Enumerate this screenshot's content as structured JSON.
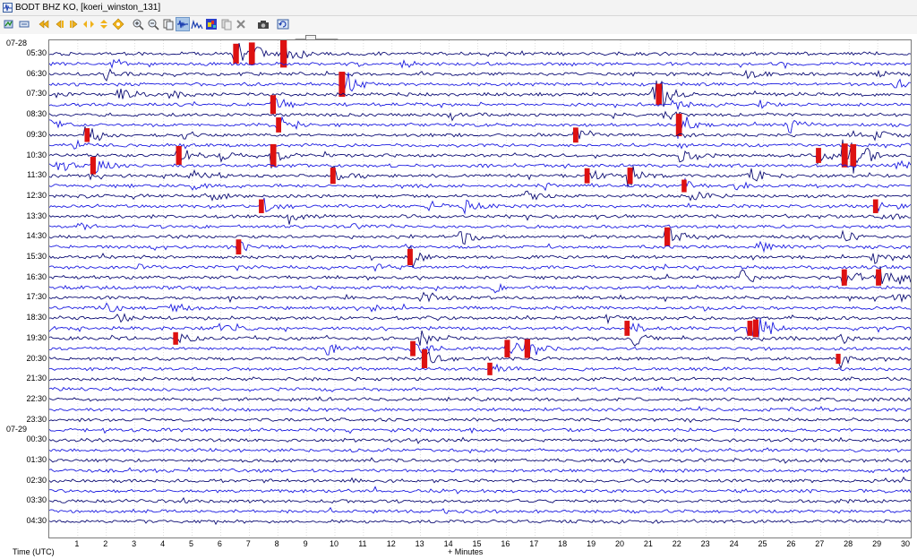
{
  "window": {
    "title": "BODT BHZ KO, [koeri_winston_131]",
    "icon": "helicorder-app-icon"
  },
  "toolbar": {
    "buttons": [
      {
        "name": "pin-icon"
      },
      {
        "name": "config-icon"
      },
      {
        "name": "back-fast-icon"
      },
      {
        "name": "back-icon"
      },
      {
        "name": "forward-icon"
      },
      {
        "name": "expand-icon"
      },
      {
        "name": "compress-icon"
      },
      {
        "name": "gear-diamond-icon"
      },
      {
        "name": "zoom-in-icon"
      },
      {
        "name": "zoom-out-icon"
      },
      {
        "name": "clip-icon"
      },
      {
        "name": "waveform-icon",
        "active": true
      },
      {
        "name": "spectra-icon"
      },
      {
        "name": "spectrogram-icon"
      },
      {
        "name": "copy-icon"
      },
      {
        "name": "close-x-icon"
      },
      {
        "name": "camera-icon"
      },
      {
        "name": "refresh-icon"
      }
    ],
    "slider": {
      "name": "gain-slider",
      "level": 0.38
    }
  },
  "helicorder": {
    "dates": [
      {
        "label": "07-28",
        "row": 0
      },
      {
        "label": "07-29",
        "row": 19
      }
    ],
    "time_labels": [
      {
        "label": "05:30",
        "row": 0
      },
      {
        "label": "06:30",
        "row": 2
      },
      {
        "label": "07:30",
        "row": 4
      },
      {
        "label": "08:30",
        "row": 6
      },
      {
        "label": "09:30",
        "row": 8
      },
      {
        "label": "10:30",
        "row": 10
      },
      {
        "label": "11:30",
        "row": 12
      },
      {
        "label": "12:30",
        "row": 14
      },
      {
        "label": "13:30",
        "row": 16
      },
      {
        "label": "14:30",
        "row": 18
      },
      {
        "label": "15:30",
        "row": 20
      },
      {
        "label": "16:30",
        "row": 22
      },
      {
        "label": "17:30",
        "row": 24
      },
      {
        "label": "18:30",
        "row": 26
      },
      {
        "label": "19:30",
        "row": 28
      },
      {
        "label": "20:30",
        "row": 30
      },
      {
        "label": "21:30",
        "row": 32
      },
      {
        "label": "22:30",
        "row": 34
      },
      {
        "label": "23:30",
        "row": 36
      },
      {
        "label": "00:30",
        "row": 38
      },
      {
        "label": "01:30",
        "row": 40
      },
      {
        "label": "02:30",
        "row": 42
      },
      {
        "label": "03:30",
        "row": 44
      },
      {
        "label": "04:30",
        "row": 46
      }
    ],
    "rows": 47,
    "x_ticks": [
      "1",
      "2",
      "3",
      "4",
      "5",
      "6",
      "7",
      "8",
      "9",
      "10",
      "11",
      "12",
      "13",
      "14",
      "15",
      "16",
      "17",
      "18",
      "19",
      "20",
      "21",
      "22",
      "23",
      "24",
      "25",
      "26",
      "27",
      "28",
      "29",
      "30"
    ],
    "x_axis_label": "+ Minutes",
    "y_axis_label": "Time (UTC)",
    "trace_colors": [
      "#0c0c74",
      "#1c1ce0"
    ],
    "event_color": "#dd1111",
    "events": [
      {
        "row": 0,
        "min": 6.5,
        "amp": 1.6,
        "red": true
      },
      {
        "row": 0,
        "min": 7.05,
        "amp": 1.8,
        "red": true
      },
      {
        "row": 0,
        "min": 8.15,
        "amp": 2.2,
        "red": true
      },
      {
        "row": 1,
        "min": 12.4,
        "amp": 0.5
      },
      {
        "row": 1,
        "min": 2.2,
        "amp": 0.5
      },
      {
        "row": 2,
        "min": 1.9,
        "amp": 0.9
      },
      {
        "row": 2,
        "min": 28.9,
        "amp": 0.6
      },
      {
        "row": 2,
        "min": 24.4,
        "amp": 0.6
      },
      {
        "row": 3,
        "min": 10.2,
        "amp": 2.0,
        "red": true
      },
      {
        "row": 3,
        "min": 29.6,
        "amp": 0.6
      },
      {
        "row": 4,
        "min": 21.3,
        "amp": 1.7,
        "red": true
      },
      {
        "row": 4,
        "min": 21.1,
        "amp": 0.9
      },
      {
        "row": 4,
        "min": 2.4,
        "amp": 0.9
      },
      {
        "row": 4,
        "min": 4.2,
        "amp": 0.9
      },
      {
        "row": 5,
        "min": 7.8,
        "amp": 1.5,
        "red": true
      },
      {
        "row": 5,
        "min": 24.8,
        "amp": 0.7
      },
      {
        "row": 5,
        "min": 21.8,
        "amp": 0.6
      },
      {
        "row": 6,
        "min": 14.0,
        "amp": 0.6
      },
      {
        "row": 6,
        "min": 21.5,
        "amp": 0.6
      },
      {
        "row": 7,
        "min": 0.0,
        "amp": 0.8
      },
      {
        "row": 7,
        "min": 22.0,
        "amp": 1.8,
        "red": true
      },
      {
        "row": 7,
        "min": 25.9,
        "amp": 0.9
      },
      {
        "row": 7,
        "min": 8.0,
        "amp": 1.2,
        "red": true
      },
      {
        "row": 8,
        "min": 1.3,
        "amp": 1.1,
        "red": true
      },
      {
        "row": 8,
        "min": 4.7,
        "amp": 0.8
      },
      {
        "row": 8,
        "min": 18.4,
        "amp": 1.2,
        "red": true
      },
      {
        "row": 8,
        "min": 28.9,
        "amp": 0.7
      },
      {
        "row": 9,
        "min": 0.9,
        "amp": 0.5
      },
      {
        "row": 9,
        "min": 29.3,
        "amp": 0.5
      },
      {
        "row": 10,
        "min": 4.5,
        "amp": 1.5,
        "red": true
      },
      {
        "row": 10,
        "min": 6.0,
        "amp": 0.9
      },
      {
        "row": 10,
        "min": 7.8,
        "amp": 1.8,
        "red": true
      },
      {
        "row": 10,
        "min": 26.9,
        "amp": 1.2,
        "red": true
      },
      {
        "row": 10,
        "min": 27.8,
        "amp": 1.9,
        "red": true
      },
      {
        "row": 10,
        "min": 28.1,
        "amp": 1.8,
        "red": true
      },
      {
        "row": 10,
        "min": 22.1,
        "amp": 0.7
      },
      {
        "row": 11,
        "min": 0.3,
        "amp": 0.8
      },
      {
        "row": 11,
        "min": 1.5,
        "amp": 1.4,
        "red": true
      },
      {
        "row": 11,
        "min": 29.7,
        "amp": 0.6
      },
      {
        "row": 12,
        "min": 5.0,
        "amp": 0.8
      },
      {
        "row": 12,
        "min": 9.9,
        "amp": 1.3,
        "red": true
      },
      {
        "row": 12,
        "min": 18.8,
        "amp": 1.2,
        "red": true
      },
      {
        "row": 12,
        "min": 20.3,
        "amp": 1.3,
        "red": true
      },
      {
        "row": 12,
        "min": 24.5,
        "amp": 1.0
      },
      {
        "row": 13,
        "min": 5.0,
        "amp": 0.6
      },
      {
        "row": 13,
        "min": 17.3,
        "amp": 0.6
      },
      {
        "row": 13,
        "min": 22.2,
        "amp": 1.0,
        "red": true
      },
      {
        "row": 13,
        "min": 23.9,
        "amp": 0.6
      },
      {
        "row": 14,
        "min": 5.6,
        "amp": 0.9
      },
      {
        "row": 14,
        "min": 16.6,
        "amp": 1.2
      },
      {
        "row": 14,
        "min": 22.4,
        "amp": 0.8
      },
      {
        "row": 15,
        "min": 7.4,
        "amp": 1.1,
        "red": true
      },
      {
        "row": 15,
        "min": 13.2,
        "amp": 0.7
      },
      {
        "row": 15,
        "min": 14.5,
        "amp": 1.2
      },
      {
        "row": 15,
        "min": 28.9,
        "amp": 1.1,
        "red": true
      },
      {
        "row": 16,
        "min": 8.4,
        "amp": 0.8
      },
      {
        "row": 16,
        "min": 29.1,
        "amp": 0.5
      },
      {
        "row": 17,
        "min": 1.0,
        "amp": 0.5
      },
      {
        "row": 17,
        "min": 10.6,
        "amp": 0.5
      },
      {
        "row": 18,
        "min": 14.4,
        "amp": 1.2
      },
      {
        "row": 18,
        "min": 21.6,
        "amp": 1.5,
        "red": true
      },
      {
        "row": 18,
        "min": 27.8,
        "amp": 0.8
      },
      {
        "row": 19,
        "min": 6.6,
        "amp": 1.2,
        "red": true
      },
      {
        "row": 19,
        "min": 24.8,
        "amp": 0.7
      },
      {
        "row": 20,
        "min": 12.6,
        "amp": 1.3,
        "red": true
      },
      {
        "row": 20,
        "min": 28.8,
        "amp": 0.8
      },
      {
        "row": 21,
        "min": 11.4,
        "amp": 0.5
      },
      {
        "row": 21,
        "min": 3.0,
        "amp": 0.5
      },
      {
        "row": 22,
        "min": 24.2,
        "amp": 1.0
      },
      {
        "row": 22,
        "min": 27.8,
        "amp": 1.3,
        "red": true
      },
      {
        "row": 22,
        "min": 29.0,
        "amp": 1.3,
        "red": true
      },
      {
        "row": 22,
        "min": 29.8,
        "amp": 0.8
      },
      {
        "row": 23,
        "min": 15.5,
        "amp": 0.6
      },
      {
        "row": 24,
        "min": 13.0,
        "amp": 0.8
      },
      {
        "row": 24,
        "min": 29.5,
        "amp": 0.5
      },
      {
        "row": 25,
        "min": 2.0,
        "amp": 0.8
      },
      {
        "row": 25,
        "min": 4.3,
        "amp": 0.6
      },
      {
        "row": 25,
        "min": 11.3,
        "amp": 0.5
      },
      {
        "row": 26,
        "min": 2.4,
        "amp": 0.7
      },
      {
        "row": 26,
        "min": 19.5,
        "amp": 0.6
      },
      {
        "row": 26,
        "min": 13.0,
        "amp": 0.5
      },
      {
        "row": 27,
        "min": 6.0,
        "amp": 0.6
      },
      {
        "row": 27,
        "min": 20.2,
        "amp": 1.2,
        "red": true
      },
      {
        "row": 27,
        "min": 24.5,
        "amp": 1.2,
        "red": true
      },
      {
        "row": 27,
        "min": 24.7,
        "amp": 1.4,
        "red": true
      },
      {
        "row": 28,
        "min": 4.4,
        "amp": 1.0,
        "red": true
      },
      {
        "row": 28,
        "min": 13.0,
        "amp": 1.0
      },
      {
        "row": 28,
        "min": 20.4,
        "amp": 1.0
      },
      {
        "row": 28,
        "min": 27.6,
        "amp": 0.7
      },
      {
        "row": 29,
        "min": 9.7,
        "amp": 0.9
      },
      {
        "row": 29,
        "min": 12.7,
        "amp": 1.2,
        "red": true
      },
      {
        "row": 29,
        "min": 16.0,
        "amp": 1.4,
        "red": true
      },
      {
        "row": 29,
        "min": 16.7,
        "amp": 1.5,
        "red": true
      },
      {
        "row": 30,
        "min": 13.1,
        "amp": 1.5,
        "red": true
      },
      {
        "row": 30,
        "min": 27.6,
        "amp": 0.8,
        "red": true
      },
      {
        "row": 31,
        "min": 15.4,
        "amp": 1.0,
        "red": true
      }
    ]
  }
}
